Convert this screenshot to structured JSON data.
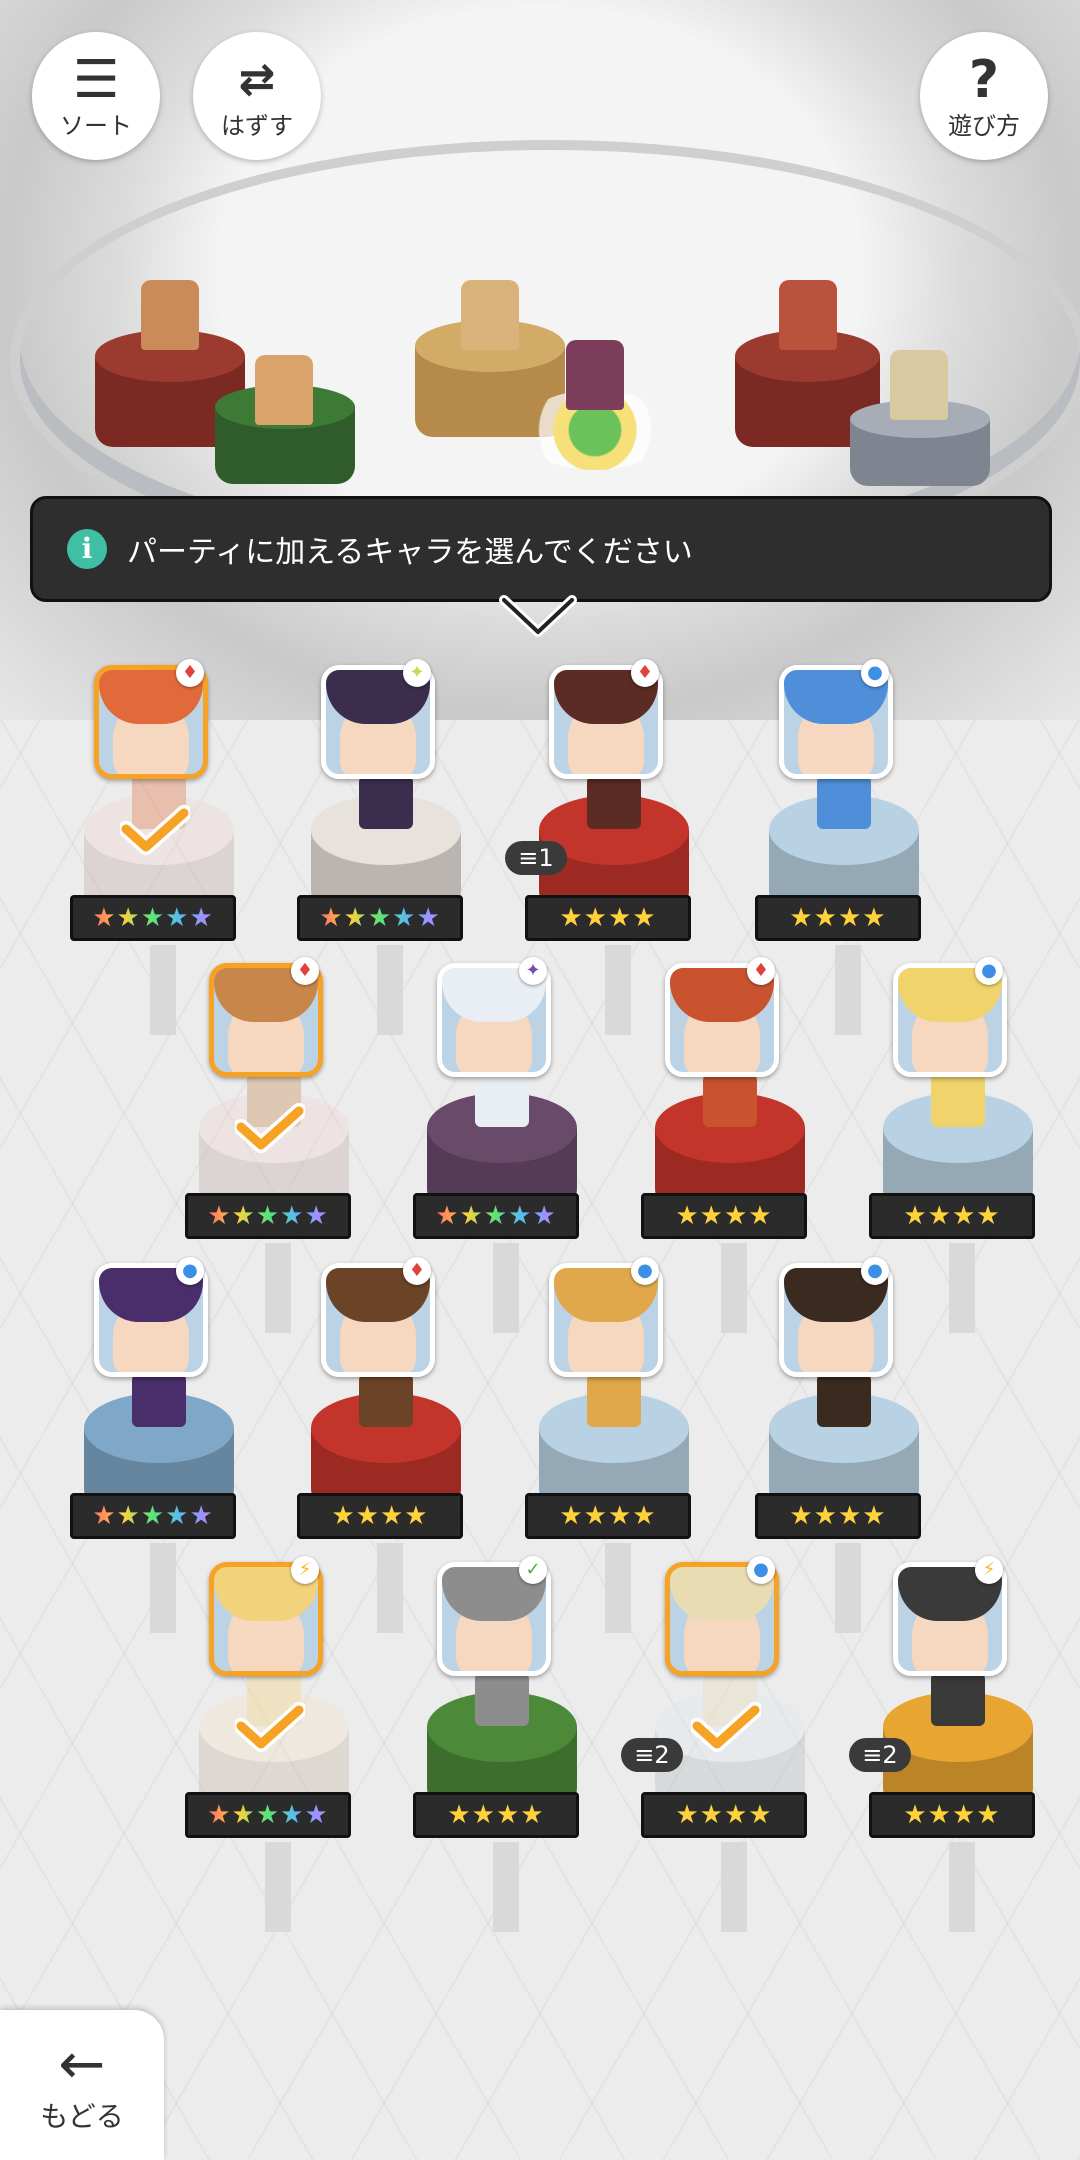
{
  "top_buttons": {
    "sort": {
      "label": "ソート",
      "icon": "sort-icon"
    },
    "remove": {
      "label": "はずす",
      "icon": "remove-member-icon"
    },
    "help": {
      "label": "遊び方",
      "icon": "question-icon"
    }
  },
  "banner": {
    "info_glyph": "i",
    "message": "パーティに加えるキャラを選んでください"
  },
  "back_button": {
    "label": "もどる",
    "icon": "arrow-left-icon"
  },
  "colors": {
    "selected_border": "#f5a225",
    "accent_check": "#f5a225",
    "info": "#3fbfa4"
  },
  "characters": [
    {
      "id": "c1",
      "stars": "★★★★★",
      "rainbow": true,
      "selected": true,
      "element": "fire",
      "count": ""
    },
    {
      "id": "c2",
      "stars": "★★★★★",
      "rainbow": true,
      "selected": false,
      "element": "light",
      "count": ""
    },
    {
      "id": "c3",
      "stars": "★★★★",
      "rainbow": false,
      "selected": false,
      "element": "fire",
      "count": "1"
    },
    {
      "id": "c4",
      "stars": "★★★★",
      "rainbow": false,
      "selected": false,
      "element": "water",
      "count": ""
    },
    {
      "id": "c5",
      "stars": "★★★★★",
      "rainbow": true,
      "selected": true,
      "element": "fire",
      "count": ""
    },
    {
      "id": "c6",
      "stars": "★★★★★",
      "rainbow": true,
      "selected": false,
      "element": "dark",
      "count": ""
    },
    {
      "id": "c7",
      "stars": "★★★★",
      "rainbow": false,
      "selected": false,
      "element": "fire",
      "count": ""
    },
    {
      "id": "c8",
      "stars": "★★★★",
      "rainbow": false,
      "selected": false,
      "element": "water",
      "count": ""
    },
    {
      "id": "c9",
      "stars": "★★★★★",
      "rainbow": true,
      "selected": false,
      "element": "water",
      "count": ""
    },
    {
      "id": "c10",
      "stars": "★★★★",
      "rainbow": false,
      "selected": false,
      "element": "fire",
      "count": ""
    },
    {
      "id": "c11",
      "stars": "★★★★",
      "rainbow": false,
      "selected": false,
      "element": "water",
      "count": ""
    },
    {
      "id": "c12",
      "stars": "★★★★",
      "rainbow": false,
      "selected": false,
      "element": "water",
      "count": ""
    },
    {
      "id": "c13",
      "stars": "★★★★★",
      "rainbow": true,
      "selected": true,
      "element": "thunder",
      "count": ""
    },
    {
      "id": "c14",
      "stars": "★★★★",
      "rainbow": false,
      "selected": false,
      "element": "wind",
      "count": ""
    },
    {
      "id": "c15",
      "stars": "★★★★",
      "rainbow": false,
      "selected": true,
      "element": "water",
      "count": "2"
    },
    {
      "id": "c16",
      "stars": "★★★★",
      "rainbow": false,
      "selected": false,
      "element": "thunder",
      "count": "2"
    }
  ]
}
